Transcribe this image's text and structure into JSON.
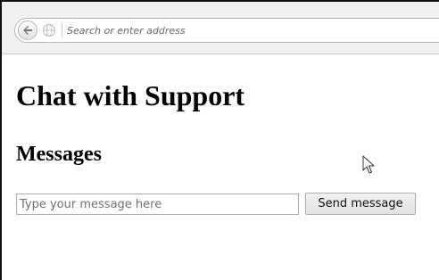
{
  "browser": {
    "address_placeholder": "Search or enter address",
    "back_icon": "arrow-left-icon",
    "site_identity_icon": "globe-icon"
  },
  "page": {
    "title": "Chat with Support",
    "messages_heading": "Messages",
    "message_input_placeholder": "Type your message here",
    "message_input_value": "",
    "send_button_label": "Send message"
  },
  "cursor": {
    "icon": "mouse-pointer-icon"
  },
  "colors": {
    "toolbar_bg": "#f1f1f1",
    "page_bg": "#ffffff",
    "text": "#000000",
    "button_bg": "#e8e8e8"
  }
}
